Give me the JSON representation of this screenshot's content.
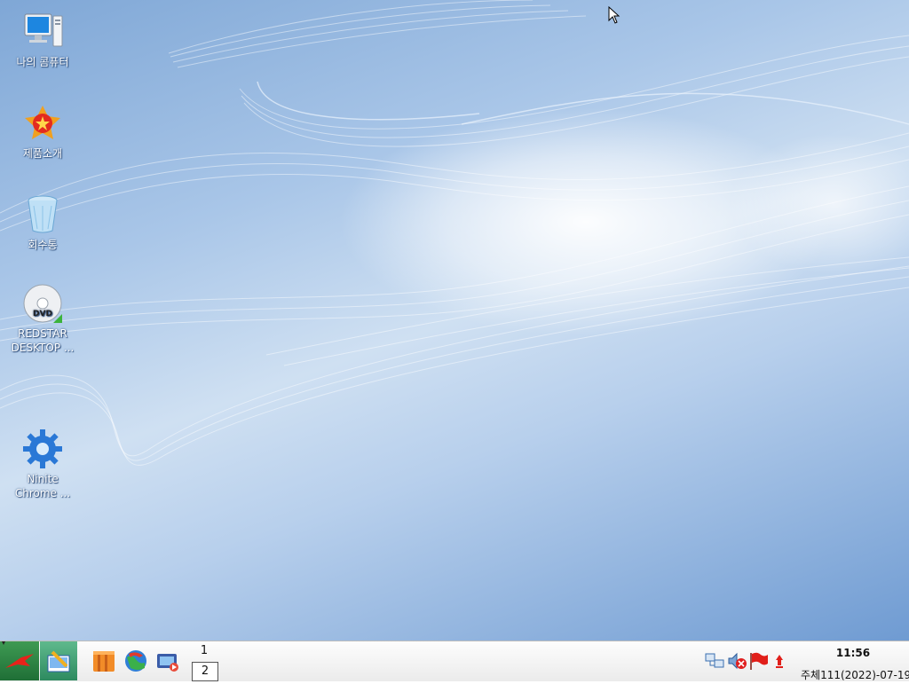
{
  "desktop": {
    "icons": [
      {
        "label": "나의 콤퓨터",
        "icon": "computer-icon"
      },
      {
        "label": "제품소개",
        "icon": "product-intro-icon"
      },
      {
        "label": "회수통",
        "icon": "recycle-bin-icon"
      },
      {
        "label": "REDSTAR\nDESKTOP ...",
        "icon": "dvd-icon"
      },
      {
        "label": "Ninite\nChrome ...",
        "icon": "gear-icon"
      }
    ]
  },
  "taskbar": {
    "start_icon": "red-star-icon",
    "show_desktop_icon": "show-desktop-icon",
    "launchers": [
      {
        "name": "office-launcher",
        "icon": "office-icon"
      },
      {
        "name": "browser-launcher",
        "icon": "globe-icon"
      },
      {
        "name": "media-launcher",
        "icon": "media-player-icon"
      }
    ],
    "pager": {
      "desk1": "1",
      "desk2": "2",
      "active": "2"
    },
    "tray": [
      {
        "name": "network-icon"
      },
      {
        "name": "volume-muted-icon"
      },
      {
        "name": "flag-icon"
      },
      {
        "name": "update-notifier-icon"
      }
    ],
    "clock": {
      "time": "11:56",
      "date": "주체111(2022)-07-19"
    }
  }
}
